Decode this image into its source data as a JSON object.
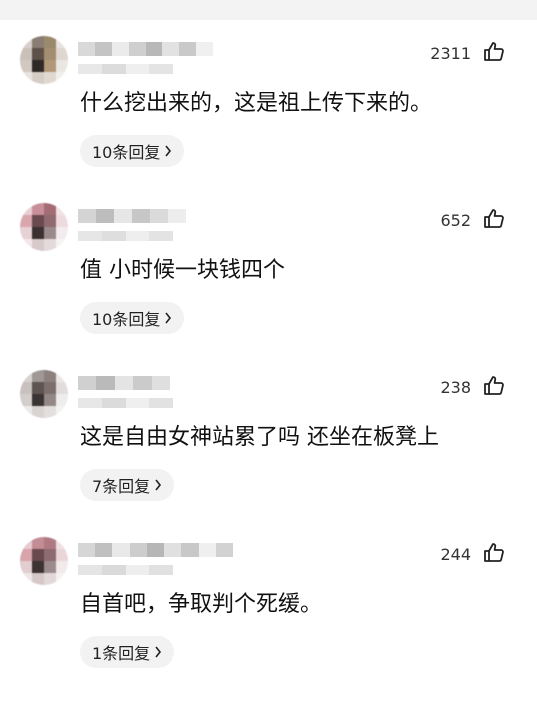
{
  "comments": [
    {
      "likes": "2311",
      "text": "什么挖出来的，这是祖上传下来的。",
      "replies": "10条回复"
    },
    {
      "likes": "652",
      "text": "值  小时候一块钱四个",
      "replies": "10条回复"
    },
    {
      "likes": "238",
      "text": "这是自由女神站累了吗 还坐在板凳上",
      "replies": "7条回复"
    },
    {
      "likes": "244",
      "text": "自首吧，争取判个死缓。",
      "replies": "1条回复"
    }
  ],
  "icons": {
    "like": "thumbs-up-icon",
    "reply_arrow": "chevron-right-icon"
  },
  "colors": {
    "reply_pill_bg": "#f2f2f2",
    "text": "#111111",
    "meta": "#333333"
  }
}
